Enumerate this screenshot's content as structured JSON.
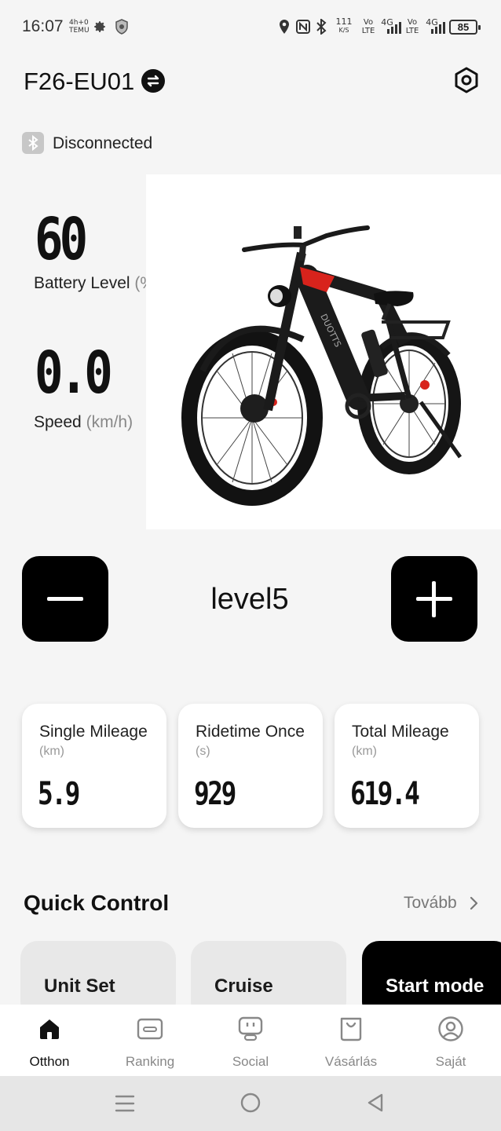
{
  "status_bar": {
    "time": "16:07",
    "mini_icon_1": "4h+0\nTEMU",
    "speed_value": "111",
    "speed_unit": "K/S",
    "volte_1": "Vo\nLTE",
    "net_1": "4G",
    "volte_2": "Vo\nLTE",
    "net_2": "4G",
    "battery": "85",
    "icons": [
      "settings-gear-icon",
      "shield-app-icon",
      "location-pin-icon",
      "nfc-icon",
      "bluetooth-icon",
      "signal-icon"
    ]
  },
  "header": {
    "device_name": "F26-EU01",
    "swap_icon": "swap-icon",
    "settings_icon": "hexagon-settings-icon"
  },
  "connection": {
    "status": "Disconnected",
    "icon": "bluetooth-icon"
  },
  "metrics": {
    "battery_value": "60",
    "battery_label": "Battery Level",
    "battery_unit": "(%",
    "speed_value": "0.0",
    "speed_label": "Speed",
    "speed_unit": "(km/h)"
  },
  "bike_image": {
    "frame_text": "DUOTTS",
    "frame_color": "#1b1b1b",
    "accent_color": "#d8231c"
  },
  "level_control": {
    "decrease_icon": "minus-icon",
    "level": "level5",
    "increase_icon": "plus-icon"
  },
  "stats": [
    {
      "title": "Single Mileage",
      "unit": "(km)",
      "value": "5.9"
    },
    {
      "title": "Ridetime Once",
      "unit": "(s)",
      "value": "929"
    },
    {
      "title": "Total Mileage",
      "unit": "(km)",
      "value": "619.4"
    }
  ],
  "quick_control": {
    "title": "Quick Control",
    "more": "Tovább",
    "items": [
      {
        "label": "Unit Set"
      },
      {
        "label": "Cruise"
      },
      {
        "label": "Start mode"
      }
    ]
  },
  "bottom_nav": [
    {
      "label": "Otthon",
      "icon": "home-icon",
      "active": true
    },
    {
      "label": "Ranking",
      "icon": "ranking-card-icon",
      "active": false
    },
    {
      "label": "Social",
      "icon": "social-robot-icon",
      "active": false
    },
    {
      "label": "Vásárlás",
      "icon": "shopping-bag-icon",
      "active": false
    },
    {
      "label": "Saját",
      "icon": "profile-icon",
      "active": false
    }
  ],
  "system_nav": [
    "recents-icon",
    "home-circle-icon",
    "back-triangle-icon"
  ],
  "colors": {
    "background": "#f5f5f5",
    "primary": "#000000",
    "muted_text": "#888888",
    "card": "#ffffff"
  }
}
